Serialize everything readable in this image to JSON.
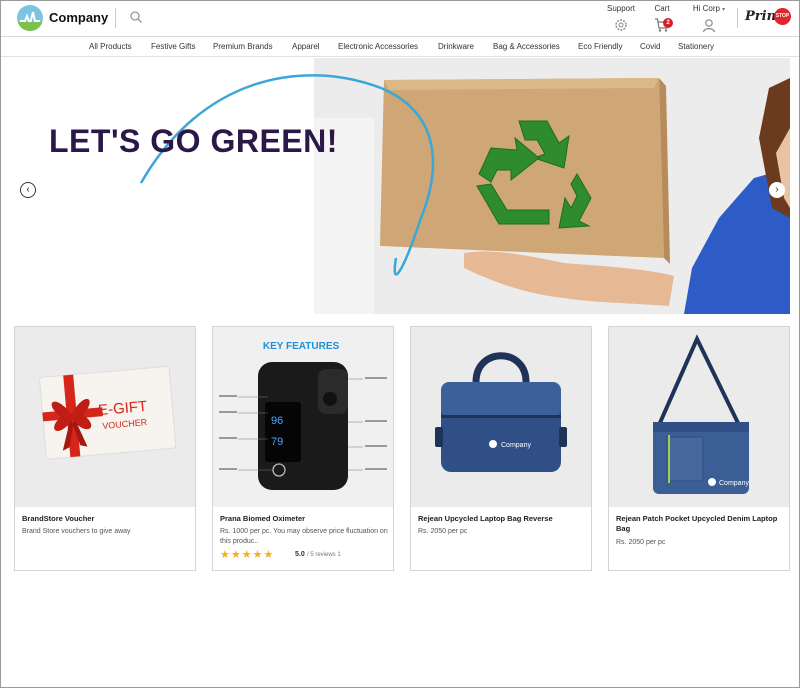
{
  "header": {
    "brand_name": "Company",
    "support_label": "Support",
    "cart_label": "Cart",
    "cart_count": "2",
    "account_label": "Hi Corp",
    "partner_text": "Print",
    "partner_badge": "STOP"
  },
  "nav": {
    "items": [
      "All Products",
      "Festive Gifts",
      "Premium Brands",
      "Apparel",
      "Electronic Accessories",
      "Drinkware",
      "Bag & Accessories",
      "Eco Friendly",
      "Covid",
      "Stationery"
    ]
  },
  "banner": {
    "headline": "LET'S GO GREEN!",
    "prev_symbol": "‹",
    "next_symbol": "›"
  },
  "products": [
    {
      "image_text_1": "E-GIFT",
      "image_text_2": "VOUCHER",
      "title": "BrandStore Voucher",
      "desc": "Brand Store vouchers to give away"
    },
    {
      "image_text_1": "KEY FEATURES",
      "image_text_2": "96",
      "image_text_3": "79",
      "title": "Prana Biomed Oximeter",
      "desc": "Rs. 1000 per pc. You may observe price fluctuation on this produc..",
      "stars": "★★★★★",
      "rating": "5.0",
      "rating_meta": "/ 5 reviews 1"
    },
    {
      "image_text_1": "Company",
      "title": "Rejean Upcycled Laptop Bag Reverse",
      "desc": "Rs. 2050 per pc"
    },
    {
      "image_text_1": "Company",
      "title": "Rejean Patch Pocket Upcycled Denim Laptop Bag",
      "desc": "Rs. 2050 per pc"
    }
  ],
  "colors": {
    "headline": "#2c1848",
    "accent_green": "#7cc24a",
    "star": "#f2b01e",
    "denim": "#2f4f86"
  }
}
